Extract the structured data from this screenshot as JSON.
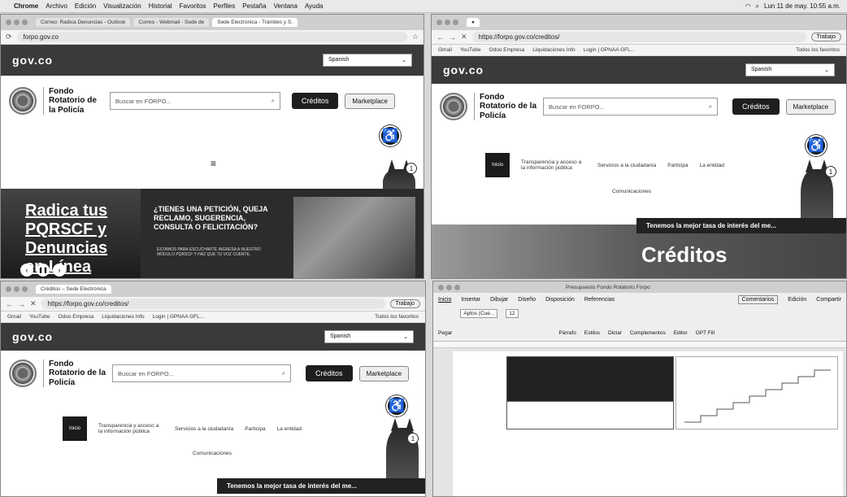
{
  "menubar": {
    "app": "Chrome",
    "items": [
      "Archivo",
      "Edición",
      "Visualización",
      "Historial",
      "Favoritos",
      "Perfiles",
      "Pestaña",
      "Ventana",
      "Ayuda"
    ],
    "clock": "Lun 11 de may. 10:55 a.m."
  },
  "w1": {
    "tabs": [
      "Correo: Radica Denuncias - Outlook",
      "Correo - Webmail - Sede de",
      "Sede Electrónica - Trámites y S."
    ],
    "url": "forpo.gov.co",
    "gov": "gov.co",
    "lang": "Spanish",
    "site_name": [
      "Fondo",
      "Rotatorio de",
      "la Policía"
    ],
    "search_placeholder": "Buscar en FORPO...",
    "btn_creditos": "Créditos",
    "btn_marketplace": "Marketplace",
    "hero_left": [
      "Radica tus",
      "PQRSCF y",
      "Denuncias",
      "en Línea"
    ],
    "hero_heading": "¿TIENES UNA PETICIÓN, QUEJA RECLAMO, SUGERENCIA, CONSULTA O FELICITACIÓN?",
    "hero_sub": "ESTAMOS PARA ESCUCHARTE INGRESA A NUESTRO MÓDULO PQRSCF Y HAZ QUE TU VOZ CUENTE."
  },
  "w2": {
    "url": "https://forpo.gov.co/creditos/",
    "bookmarks": [
      "Gmail",
      "YouTube",
      "Odoo Empresa",
      "Liquidaciones Info",
      "Login | GPNAA GFL...",
      "Todos los favoritos"
    ],
    "profile": "Trabajo",
    "gov": "gov.co",
    "lang": "Spanish",
    "site_name": [
      "Fondo",
      "Rotatorio de la",
      "Policía"
    ],
    "search_placeholder": "Buscar en FORPO...",
    "btn_creditos": "Créditos",
    "btn_marketplace": "Marketplace",
    "menu_inicio": "Inicio",
    "menu": [
      "Transparencia y acceso a la información pública",
      "Servicios a la ciudadanía",
      "Participa",
      "La entidad"
    ],
    "menu_extra": "Comunicaciones",
    "banner": "Tenemos la mejor tasa de interés del me...",
    "hero_title": "Créditos"
  },
  "w3": {
    "tab": "Créditos – Sede Electrónica",
    "url": "https://forpo.gov.co/creditos/",
    "profile": "Trabajo",
    "bookmarks": [
      "Gmail",
      "YouTube",
      "Odoo Empresa",
      "Liquidaciones Info",
      "Login | GPNAA GFL...",
      "Todos los favoritos"
    ],
    "gov": "gov.co",
    "lang": "Spanish",
    "site_name": [
      "Fondo",
      "Rotatorio de la",
      "Policía"
    ],
    "search_placeholder": "Buscar en FORPO...",
    "btn_creditos": "Créditos",
    "btn_marketplace": "Marketplace",
    "menu_inicio": "Inicio",
    "menu": [
      "Transparencia y acceso a la información pública",
      "Servicios a la ciudadanía",
      "Participa",
      "La entidad"
    ],
    "menu_extra": "Comunicaciones",
    "banner": "Tenemos la mejor tasa de interés del me..."
  },
  "w4": {
    "title": "Presupuesto Fondo Rotatorio Forpo",
    "ribbon_tabs": [
      "Inicio",
      "Insertar",
      "Dibujar",
      "Diseño",
      "Disposición",
      "Referencias"
    ],
    "right_actions": [
      "Comentarios",
      "Edición",
      "Compartir"
    ],
    "font": "Aptos (Cue...",
    "size": "12",
    "groups": [
      "Pegar",
      "Párrafo",
      "Estilos",
      "Dictar",
      "Complementos",
      "Editor",
      "GPT Fill"
    ]
  }
}
